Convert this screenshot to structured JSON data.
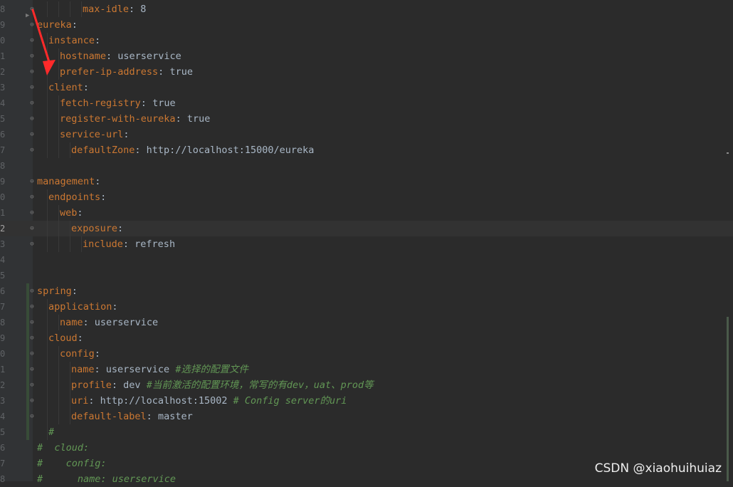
{
  "editor": {
    "lines": [
      {
        "num": "8",
        "indent": 4,
        "key": "max-idle",
        "sep": ": ",
        "val": "8",
        "comment": ""
      },
      {
        "num": "9",
        "indent": 0,
        "key": "eureka",
        "sep": ":",
        "val": "",
        "comment": ""
      },
      {
        "num": "0",
        "indent": 1,
        "key": "instance",
        "sep": ":",
        "val": "",
        "comment": ""
      },
      {
        "num": "1",
        "indent": 2,
        "key": "hostname",
        "sep": ": ",
        "val": "userservice",
        "comment": ""
      },
      {
        "num": "2",
        "indent": 2,
        "key": "prefer-ip-address",
        "sep": ": ",
        "val": "true",
        "comment": ""
      },
      {
        "num": "3",
        "indent": 1,
        "key": "client",
        "sep": ":",
        "val": "",
        "comment": ""
      },
      {
        "num": "4",
        "indent": 2,
        "key": "fetch-registry",
        "sep": ": ",
        "val": "true",
        "comment": ""
      },
      {
        "num": "5",
        "indent": 2,
        "key": "register-with-eureka",
        "sep": ": ",
        "val": "true",
        "comment": ""
      },
      {
        "num": "6",
        "indent": 2,
        "key": "service-url",
        "sep": ":",
        "val": "",
        "comment": ""
      },
      {
        "num": "7",
        "indent": 3,
        "key": "defaultZone",
        "sep": ": ",
        "val": "http://localhost:15000/eureka",
        "comment": ""
      },
      {
        "num": "8",
        "indent": 0,
        "key": "",
        "sep": "",
        "val": "",
        "comment": ""
      },
      {
        "num": "9",
        "indent": 0,
        "key": "management",
        "sep": ":",
        "val": "",
        "comment": ""
      },
      {
        "num": "0",
        "indent": 1,
        "key": "endpoints",
        "sep": ":",
        "val": "",
        "comment": ""
      },
      {
        "num": "1",
        "indent": 2,
        "key": "web",
        "sep": ":",
        "val": "",
        "comment": ""
      },
      {
        "num": "2",
        "indent": 3,
        "key": "exposure",
        "sep": ":",
        "val": "",
        "comment": "",
        "current": true
      },
      {
        "num": "3",
        "indent": 4,
        "key": "include",
        "sep": ": ",
        "val": "refresh",
        "comment": ""
      },
      {
        "num": "4",
        "indent": 0,
        "key": "",
        "sep": "",
        "val": "",
        "comment": ""
      },
      {
        "num": "5",
        "indent": 0,
        "key": "",
        "sep": "",
        "val": "",
        "comment": ""
      },
      {
        "num": "6",
        "indent": 0,
        "key": "spring",
        "sep": ":",
        "val": "",
        "comment": ""
      },
      {
        "num": "7",
        "indent": 1,
        "key": "application",
        "sep": ":",
        "val": "",
        "comment": ""
      },
      {
        "num": "8",
        "indent": 2,
        "key": "name",
        "sep": ": ",
        "val": "userservice",
        "comment": ""
      },
      {
        "num": "9",
        "indent": 1,
        "key": "cloud",
        "sep": ":",
        "val": "",
        "comment": ""
      },
      {
        "num": "0",
        "indent": 2,
        "key": "config",
        "sep": ":",
        "val": "",
        "comment": ""
      },
      {
        "num": "1",
        "indent": 3,
        "key": "name",
        "sep": ": ",
        "val": "userservice ",
        "comment": "#选择的配置文件"
      },
      {
        "num": "2",
        "indent": 3,
        "key": "profile",
        "sep": ": ",
        "val": "dev ",
        "comment": "#当前激活的配置环境，常写的有dev，uat、prod等"
      },
      {
        "num": "3",
        "indent": 3,
        "key": "uri",
        "sep": ": ",
        "val": "http://localhost:15002 ",
        "comment": "# Config server的uri"
      },
      {
        "num": "4",
        "indent": 3,
        "key": "default-label",
        "sep": ": ",
        "val": "master",
        "comment": ""
      },
      {
        "num": "5",
        "indent": 1,
        "key": "",
        "sep": "",
        "val": "",
        "comment": "#"
      },
      {
        "num": "6",
        "indent": 0,
        "key": "",
        "sep": "",
        "val": "",
        "comment": "#  cloud:"
      },
      {
        "num": "7",
        "indent": 0,
        "key": "",
        "sep": "",
        "val": "",
        "comment": "#    config:"
      },
      {
        "num": "8",
        "indent": 0,
        "key": "",
        "sep": "",
        "val": "",
        "comment": "#      name: userservice"
      }
    ]
  },
  "watermark": {
    "text": "CSDN @xiaohuihuiaz"
  },
  "colors": {
    "key": "#cc7832",
    "value": "#a9b7c6",
    "comment": "#629755",
    "background": "#2b2b2b",
    "annotation": "#ff2a2a"
  }
}
